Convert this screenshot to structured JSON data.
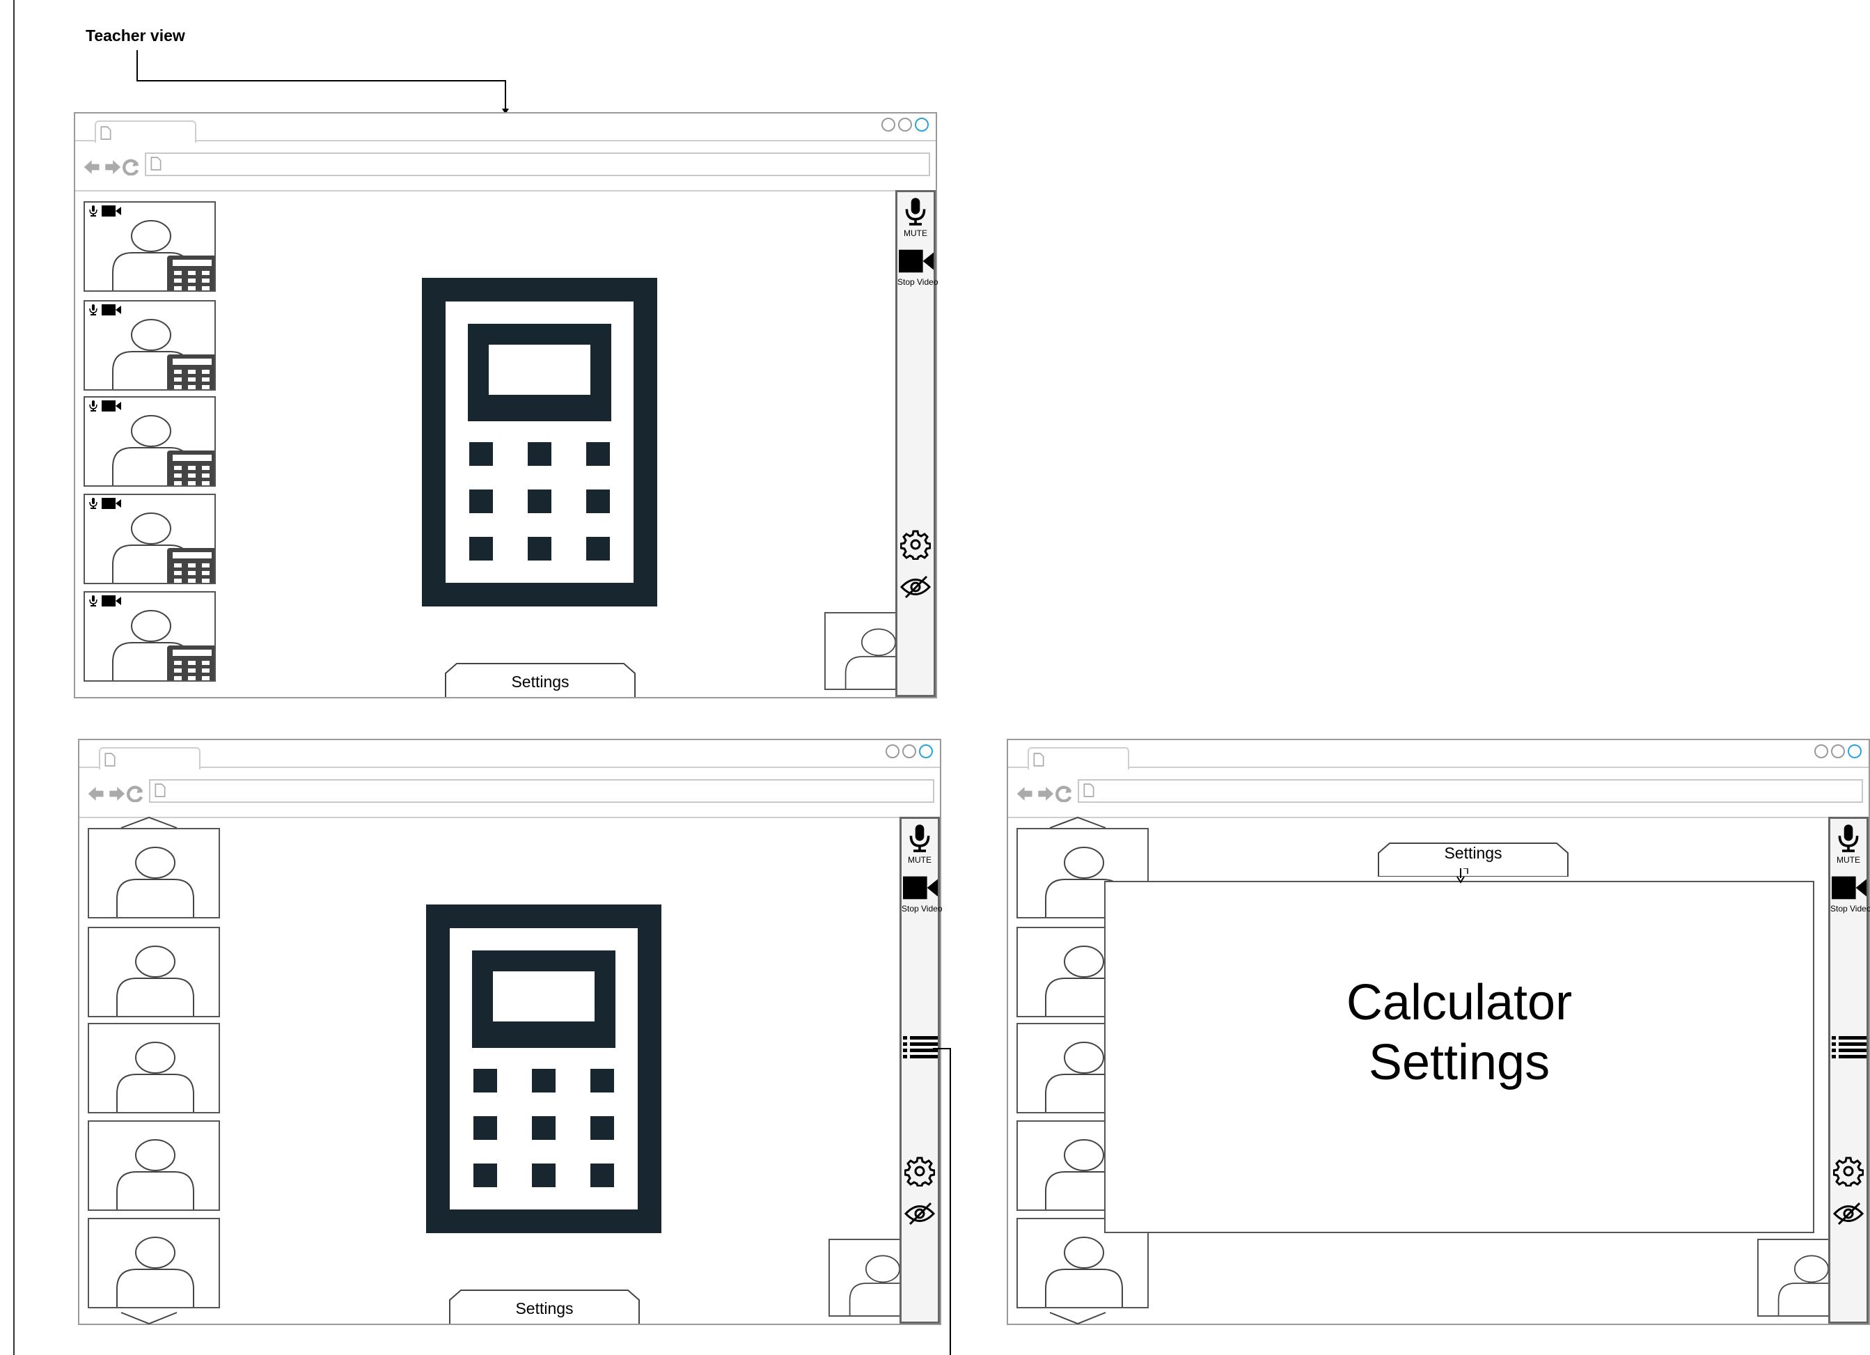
{
  "diagram": {
    "title": "Teacher view"
  },
  "frame_top": {
    "sidebar": {
      "mute_label": "MUTE",
      "video_label": "Stop Video"
    },
    "settings_label": "Settings"
  },
  "frame_bottom_left": {
    "sidebar": {
      "mute_label": "MUTE",
      "video_label": "Stop Video"
    },
    "settings_label": "Settings"
  },
  "frame_bottom_right": {
    "sidebar": {
      "mute_label": "MUTE",
      "video_label": "Stop Video"
    },
    "settings_label": "Settings",
    "modal": {
      "line1": "Calculator",
      "line2": "Settings"
    }
  },
  "icons": {
    "participant": "person-silhouette-icon",
    "calculator": "calculator-icon",
    "mic": "microphone-icon",
    "camera": "video-camera-icon",
    "settings": "gear-icon",
    "hide": "eye-slash-icon",
    "list": "list-icon"
  },
  "colors": {
    "calculator_dark": "#17262f",
    "window_button_active": "#29a3e0",
    "sidebar_bg": "#f4f4f4"
  }
}
